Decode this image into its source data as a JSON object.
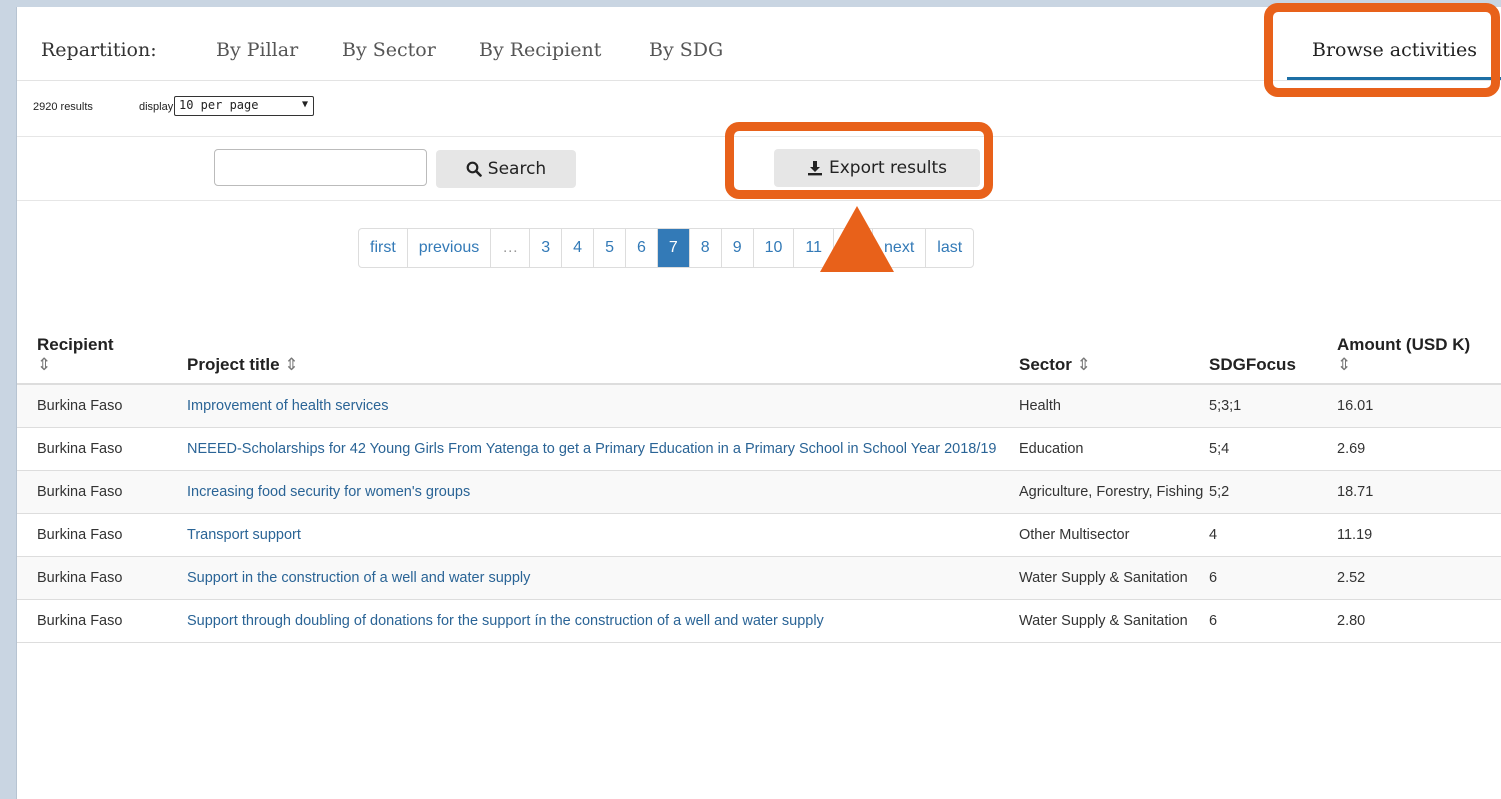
{
  "tabs": {
    "label": "Repartition:",
    "items": [
      "By Pillar",
      "By Sector",
      "By Recipient",
      "By SDG"
    ],
    "browse": "Browse activities"
  },
  "results": {
    "count": "2920 results",
    "display_label": "display",
    "display_value": "10 per page"
  },
  "search": {
    "placeholder": "",
    "button": "Search",
    "export": "Export results"
  },
  "pager": [
    "first",
    "previous",
    "…",
    "3",
    "4",
    "5",
    "6",
    "7",
    "8",
    "9",
    "10",
    "11",
    "…",
    "next",
    "last"
  ],
  "pager_active": "7",
  "table": {
    "headers": {
      "recipient": "Recipient",
      "title": "Project title",
      "sector": "Sector",
      "sdg": "SDGFocus",
      "amount": "Amount (USD K)"
    },
    "rows": [
      {
        "recipient": "Burkina Faso",
        "title": "Improvement of health services",
        "sector": "Health",
        "sdg": "5;3;1",
        "amount": "16.01"
      },
      {
        "recipient": "Burkina Faso",
        "title": "NEEED-Scholarships for 42 Young Girls From Yatenga to get a Primary Education in a Primary School in School Year 2018/19",
        "sector": "Education",
        "sdg": "5;4",
        "amount": "2.69"
      },
      {
        "recipient": "Burkina Faso",
        "title": "Increasing food security for women's groups",
        "sector": "Agriculture, Forestry, Fishing",
        "sdg": "5;2",
        "amount": "18.71"
      },
      {
        "recipient": "Burkina Faso",
        "title": "Transport support",
        "sector": "Other Multisector",
        "sdg": "4",
        "amount": "11.19"
      },
      {
        "recipient": "Burkina Faso",
        "title": "Support in the construction of a well and water supply",
        "sector": "Water Supply & Sanitation",
        "sdg": "6",
        "amount": "2.52"
      },
      {
        "recipient": "Burkina Faso",
        "title": "Support through doubling of donations for the support ín the construction of a well and water supply",
        "sector": "Water Supply & Sanitation",
        "sdg": "6",
        "amount": "2.80"
      }
    ]
  },
  "colors": {
    "highlight": "#e8611a",
    "link": "#2a6496",
    "active_page": "#337ab7"
  }
}
